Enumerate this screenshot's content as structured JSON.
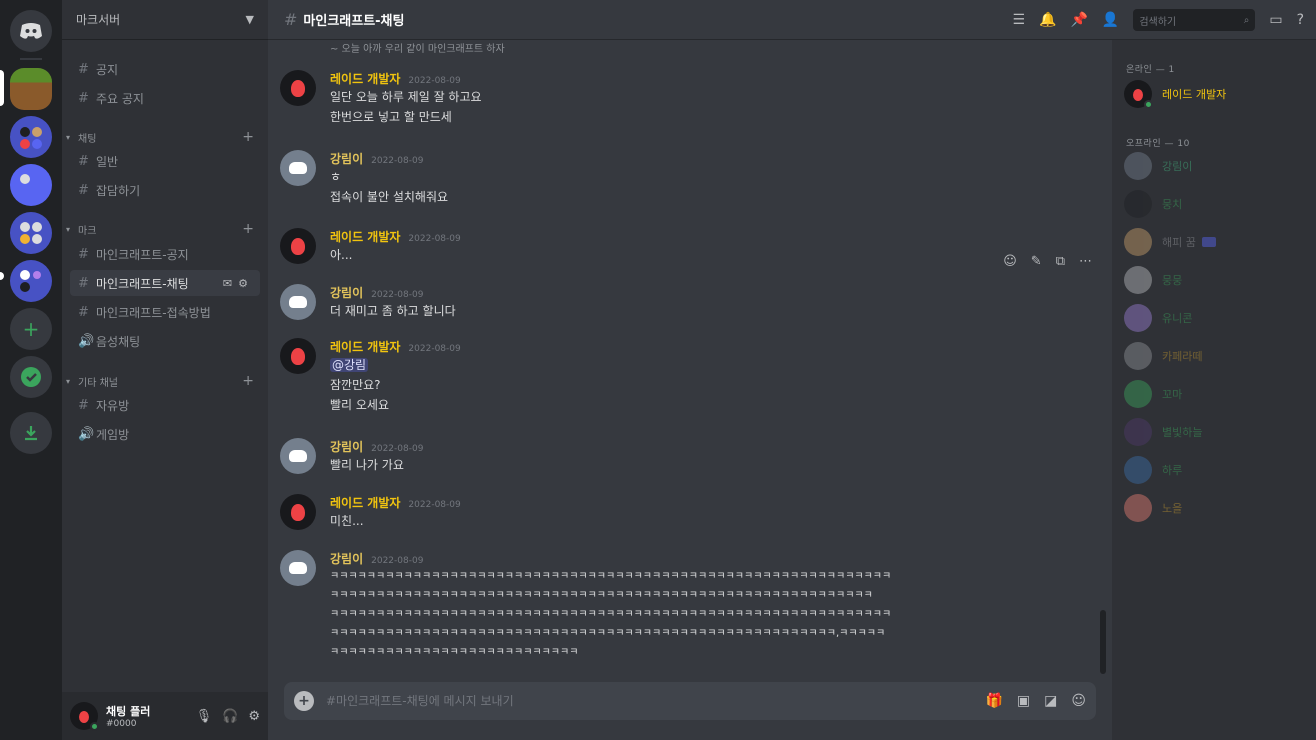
{
  "server_rail": {
    "servers": [
      "discord-home",
      "server-1",
      "server-2",
      "server-3",
      "server-4",
      "server-5",
      "add-server",
      "explore",
      "download"
    ]
  },
  "sidebar": {
    "guild_name": "마크서버",
    "top_channels": [
      "공지",
      "주요 공지"
    ],
    "categories": [
      {
        "name": "채팅",
        "channels": [
          "일반",
          "잡담하기"
        ]
      },
      {
        "name": "마크",
        "channels": [
          "마인크래프트-공지",
          "마인크래프트-채팅",
          "마인크래프트-접속방법",
          "음성채팅"
        ]
      },
      {
        "name": "기타 채널",
        "channels": [
          "자유방",
          "게임방"
        ]
      }
    ],
    "active_channel": "마인크래프트-채팅"
  },
  "user_panel": {
    "name": "채팅 플러",
    "tag": "#0000"
  },
  "chat": {
    "channel_title": "마인크래프트-채팅",
    "search_placeholder": "검색하기",
    "partial_top_text": "~ 오늘 아까 우리 같이 마인크래프트 하자",
    "composer_placeholder": "#마인크래프트-채팅에 메시지 보내기",
    "messages": [
      {
        "author": "레이드 개발자",
        "time": "2022-08-09",
        "lines": [
          "일단 오늘 하루 제일 잘 하고요",
          "한번으로 넣고 할 만드세"
        ]
      },
      {
        "author": "강림이",
        "time": "2022-08-09",
        "lines": [
          "ㅎ",
          "접속이 불안 설치해줘요"
        ]
      },
      {
        "author": "레이드 개발자",
        "time": "2022-08-09",
        "lines": [
          "아..."
        ]
      },
      {
        "author": "강림이",
        "time": "2022-08-09",
        "lines": [
          "더 재미고 좀 하고 할니다"
        ]
      },
      {
        "author": "레이드 개발자",
        "time": "2022-08-09",
        "lines": [
          "@강림",
          "잠깐만요?",
          "빨리 오세요"
        ]
      },
      {
        "author": "강림이",
        "time": "2022-08-09",
        "lines": [
          "빨리 나가 가요"
        ]
      },
      {
        "author": "레이드 개발자",
        "time": "2022-08-09",
        "lines": [
          "미친..."
        ]
      },
      {
        "author": "강림이",
        "time": "2022-08-09",
        "lines": [
          "ㅋㅋㅋㅋㅋㅋㅋㅋㅋㅋㅋㅋㅋㅋㅋㅋㅋㅋㅋㅋㅋㅋㅋㅋㅋㅋㅋㅋㅋㅋㅋㅋㅋㅋㅋㅋㅋㅋㅋㅋㅋㅋㅋㅋㅋㅋㅋㅋㅋㅋㅋㅋㅋㅋㅋㅋㅋㅋㅋㅋㅋ",
          "ㅋㅋㅋㅋㅋㅋㅋㅋㅋㅋㅋㅋㅋㅋㅋㅋㅋㅋㅋㅋㅋㅋㅋㅋㅋㅋㅋㅋㅋㅋㅋㅋㅋㅋㅋㅋㅋㅋㅋㅋㅋㅋㅋㅋㅋㅋㅋㅋㅋㅋㅋㅋㅋㅋㅋㅋㅋㅋㅋ",
          "ㅋㅋㅋㅋㅋㅋㅋㅋㅋㅋㅋㅋㅋㅋㅋㅋㅋㅋㅋㅋㅋㅋㅋㅋㅋㅋㅋㅋㅋㅋㅋㅋㅋㅋㅋㅋㅋㅋㅋㅋㅋㅋㅋㅋㅋㅋㅋㅋㅋㅋㅋㅋㅋㅋㅋㅋㅋㅋㅋㅋㅋ",
          "ㅋㅋㅋㅋㅋㅋㅋㅋㅋㅋㅋㅋㅋㅋㅋㅋㅋㅋㅋㅋㅋㅋㅋㅋㅋㅋㅋㅋㅋㅋㅋㅋㅋㅋㅋㅋㅋㅋㅋㅋㅋㅋㅋㅋㅋㅋㅋㅋㅋㅋㅋㅋㅋㅋㅋ,ㅋㅋㅋㅋㅋ",
          "ㅋㅋㅋㅋㅋㅋㅋㅋㅋㅋㅋㅋㅋㅋㅋㅋㅋㅋㅋㅋㅋㅋㅋㅋㅋㅋㅋ"
        ]
      }
    ]
  },
  "members": {
    "online_header": "온라인 — 1",
    "online": [
      {
        "name": "레이드 개발자",
        "color": "#f1c40f"
      }
    ],
    "offline_header": "오프라인 — 10",
    "offline": [
      {
        "name": "강림이",
        "color": "#43b581"
      },
      {
        "name": "뭉치",
        "color": "#3ba55d"
      },
      {
        "name": "해피 꿈",
        "color": "#96989d"
      },
      {
        "name": "뭉뭉",
        "color": "#3ba55d"
      },
      {
        "name": "유니콘",
        "color": "#3ba55d"
      },
      {
        "name": "카페라떼",
        "color": "#c79a2f"
      },
      {
        "name": "꼬마",
        "color": "#3ba55d"
      },
      {
        "name": "별빛하늘",
        "color": "#3ba55d"
      },
      {
        "name": "하루",
        "color": "#3ba55d"
      },
      {
        "name": "노을",
        "color": "#c79a2f"
      }
    ]
  },
  "colors": {
    "rail": "#202225",
    "sidebar": "#2f3136",
    "chat": "#36393f",
    "accent": "#5865f2",
    "online": "#3ba55d"
  }
}
